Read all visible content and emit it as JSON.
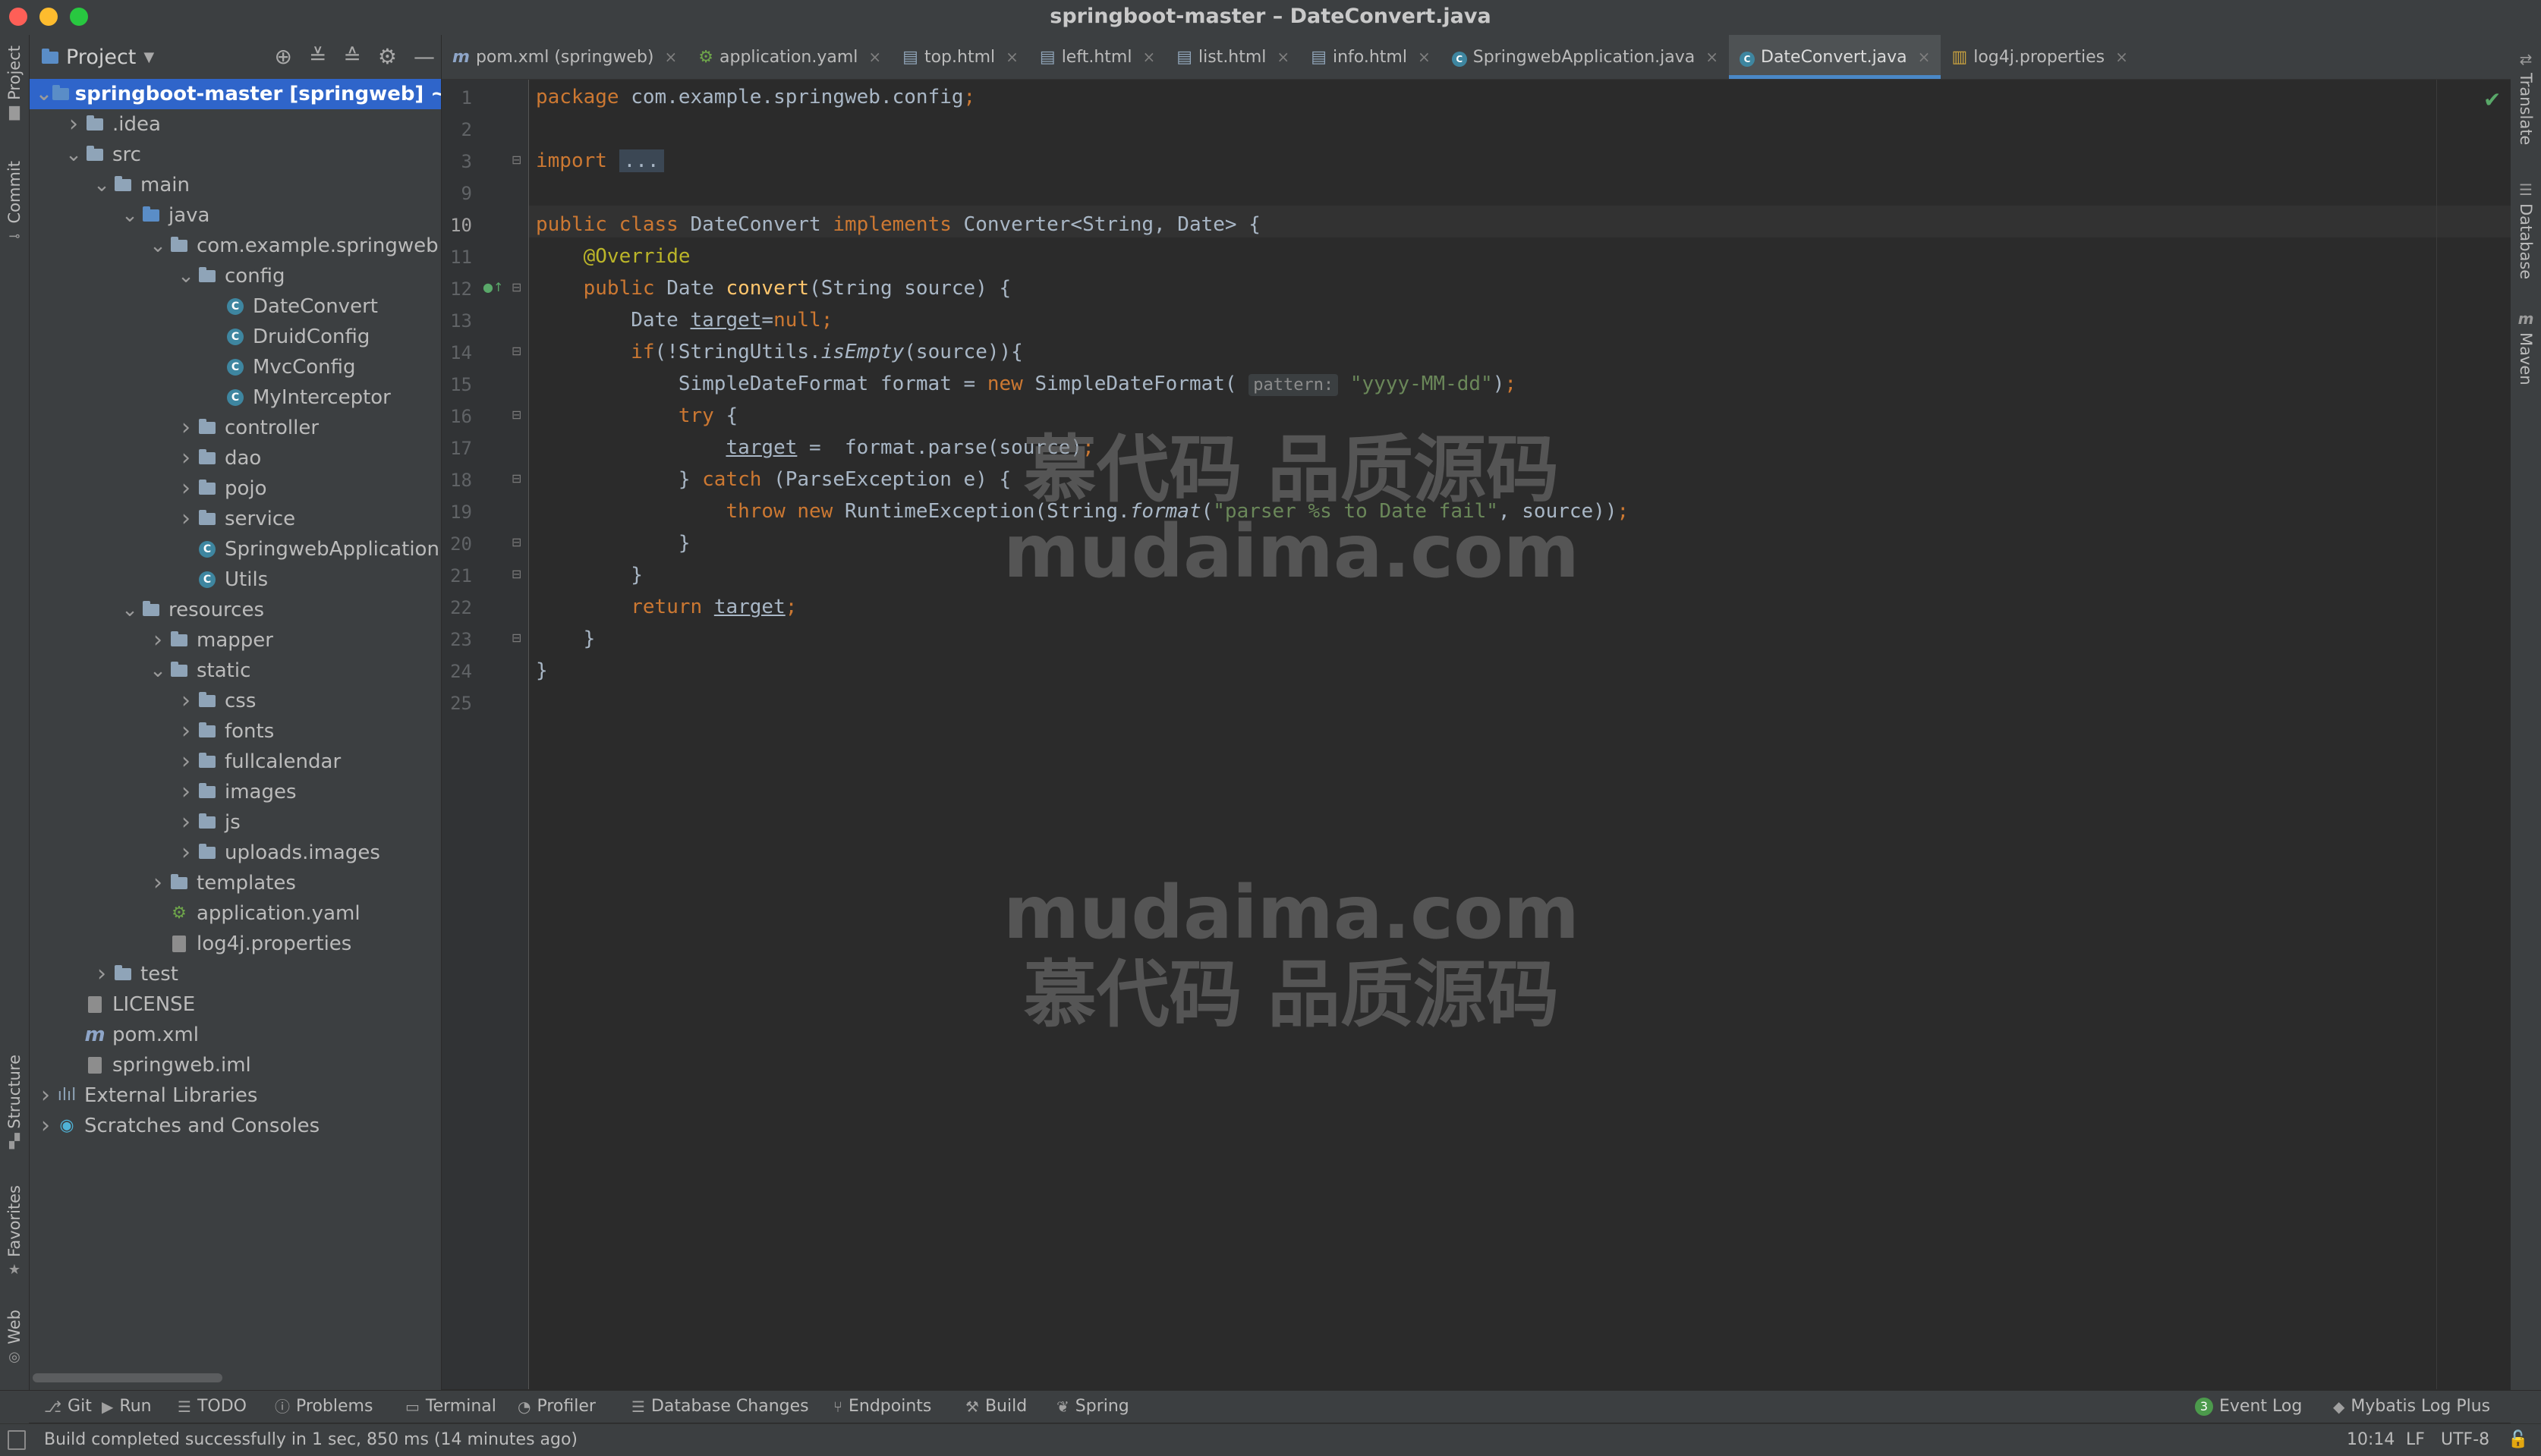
{
  "window": {
    "title": "springboot-master – DateConvert.java"
  },
  "left_strip": [
    {
      "label": "Project",
      "icon": "folder-icon"
    },
    {
      "label": "Commit",
      "icon": "commit-icon"
    },
    {
      "label": "Structure",
      "icon": "structure-icon"
    },
    {
      "label": "Favorites",
      "icon": "star-icon"
    },
    {
      "label": "Web",
      "icon": "web-icon"
    }
  ],
  "right_strip": [
    {
      "label": "Translate",
      "icon": "translate-icon"
    },
    {
      "label": "Database",
      "icon": "database-icon"
    },
    {
      "label": "Maven",
      "icon": "maven-icon"
    }
  ],
  "project_panel": {
    "title": "Project",
    "tree": [
      {
        "label": "springboot-master [springweb] ~/De",
        "depth": 0,
        "arrow": "down",
        "icon": "folder-blue",
        "selected": true
      },
      {
        "label": ".idea",
        "depth": 1,
        "arrow": "right",
        "icon": "folder"
      },
      {
        "label": "src",
        "depth": 1,
        "arrow": "down",
        "icon": "folder"
      },
      {
        "label": "main",
        "depth": 2,
        "arrow": "down",
        "icon": "folder"
      },
      {
        "label": "java",
        "depth": 3,
        "arrow": "down",
        "icon": "folder-blue"
      },
      {
        "label": "com.example.springweb",
        "depth": 4,
        "arrow": "down",
        "icon": "folder"
      },
      {
        "label": "config",
        "depth": 5,
        "arrow": "down",
        "icon": "folder"
      },
      {
        "label": "DateConvert",
        "depth": 6,
        "arrow": "",
        "icon": "class"
      },
      {
        "label": "DruidConfig",
        "depth": 6,
        "arrow": "",
        "icon": "class"
      },
      {
        "label": "MvcConfig",
        "depth": 6,
        "arrow": "",
        "icon": "class"
      },
      {
        "label": "MyInterceptor",
        "depth": 6,
        "arrow": "",
        "icon": "class"
      },
      {
        "label": "controller",
        "depth": 5,
        "arrow": "right",
        "icon": "folder"
      },
      {
        "label": "dao",
        "depth": 5,
        "arrow": "right",
        "icon": "folder"
      },
      {
        "label": "pojo",
        "depth": 5,
        "arrow": "right",
        "icon": "folder"
      },
      {
        "label": "service",
        "depth": 5,
        "arrow": "right",
        "icon": "folder"
      },
      {
        "label": "SpringwebApplication",
        "depth": 5,
        "arrow": "",
        "icon": "class"
      },
      {
        "label": "Utils",
        "depth": 5,
        "arrow": "",
        "icon": "class"
      },
      {
        "label": "resources",
        "depth": 3,
        "arrow": "down",
        "icon": "folder"
      },
      {
        "label": "mapper",
        "depth": 4,
        "arrow": "right",
        "icon": "folder"
      },
      {
        "label": "static",
        "depth": 4,
        "arrow": "down",
        "icon": "folder"
      },
      {
        "label": "css",
        "depth": 5,
        "arrow": "right",
        "icon": "folder"
      },
      {
        "label": "fonts",
        "depth": 5,
        "arrow": "right",
        "icon": "folder"
      },
      {
        "label": "fullcalendar",
        "depth": 5,
        "arrow": "right",
        "icon": "folder"
      },
      {
        "label": "images",
        "depth": 5,
        "arrow": "right",
        "icon": "folder"
      },
      {
        "label": "js",
        "depth": 5,
        "arrow": "right",
        "icon": "folder"
      },
      {
        "label": "uploads.images",
        "depth": 5,
        "arrow": "right",
        "icon": "folder"
      },
      {
        "label": "templates",
        "depth": 4,
        "arrow": "right",
        "icon": "folder"
      },
      {
        "label": "application.yaml",
        "depth": 4,
        "arrow": "",
        "icon": "yaml"
      },
      {
        "label": "log4j.properties",
        "depth": 4,
        "arrow": "",
        "icon": "file"
      },
      {
        "label": "test",
        "depth": 2,
        "arrow": "right",
        "icon": "folder"
      },
      {
        "label": "LICENSE",
        "depth": 1,
        "arrow": "",
        "icon": "file"
      },
      {
        "label": "pom.xml",
        "depth": 1,
        "arrow": "",
        "icon": "maven"
      },
      {
        "label": "springweb.iml",
        "depth": 1,
        "arrow": "",
        "icon": "file"
      },
      {
        "label": "External Libraries",
        "depth": 0,
        "arrow": "right",
        "icon": "library"
      },
      {
        "label": "Scratches and Consoles",
        "depth": 0,
        "arrow": "right",
        "icon": "scratch"
      }
    ]
  },
  "tabs": [
    {
      "label": "pom.xml (springweb)",
      "icon": "maven",
      "active": false
    },
    {
      "label": "application.yaml",
      "icon": "yaml",
      "active": false
    },
    {
      "label": "top.html",
      "icon": "html",
      "active": false
    },
    {
      "label": "left.html",
      "icon": "html",
      "active": false
    },
    {
      "label": "list.html",
      "icon": "html",
      "active": false
    },
    {
      "label": "info.html",
      "icon": "html",
      "active": false
    },
    {
      "label": "SpringwebApplication.java",
      "icon": "spring-class",
      "active": false
    },
    {
      "label": "DateConvert.java",
      "icon": "class",
      "active": true
    },
    {
      "label": "log4j.properties",
      "icon": "properties",
      "active": false
    }
  ],
  "editor": {
    "current_line": 10,
    "lines": [
      {
        "n": 1,
        "html": "<span class=\"kw\">package</span> com.example.springweb.config<span class=\"kw\">;</span>"
      },
      {
        "n": 2,
        "html": ""
      },
      {
        "n": 3,
        "html": "<span class=\"kw\">import</span> <span class=\"foldbox\">...</span>"
      },
      {
        "n": 9,
        "html": ""
      },
      {
        "n": 10,
        "html": "<span class=\"kw\">public class</span> DateConvert <span class=\"kw\">implements</span> Converter&lt;String, Date&gt; {"
      },
      {
        "n": 11,
        "html": "    <span class=\"an\">@Override</span>"
      },
      {
        "n": 12,
        "html": "    <span class=\"kw\">public</span> Date <span class=\"fn\">convert</span>(String source) {"
      },
      {
        "n": 13,
        "html": "        Date <span class=\"ul\">target</span>=<span class=\"kw\">null;</span>"
      },
      {
        "n": 14,
        "html": "        <span class=\"kw\">if</span>(!StringUtils.<span class=\"it\">isEmpty</span>(source)){"
      },
      {
        "n": 15,
        "html": "            SimpleDateFormat format = <span class=\"kw\">new</span> SimpleDateFormat( <span class=\"hint\">pattern:</span> <span class=\"str\">\"yyyy-MM-dd\"</span>)<span class=\"kw\">;</span>"
      },
      {
        "n": 16,
        "html": "            <span class=\"kw\">try</span> {"
      },
      {
        "n": 17,
        "html": "                <span class=\"ul\">target</span> =  format.parse(source)<span class=\"kw\">;</span>"
      },
      {
        "n": 18,
        "html": "            } <span class=\"kw\">catch</span> (ParseException e) {"
      },
      {
        "n": 19,
        "html": "                <span class=\"kw\">throw new</span> RuntimeException(String.<span class=\"it\">format</span>(<span class=\"str\">\"parser %s to Date fail\"</span>, source))<span class=\"kw\">;</span>"
      },
      {
        "n": 20,
        "html": "            }"
      },
      {
        "n": 21,
        "html": "        }"
      },
      {
        "n": 22,
        "html": "        <span class=\"kw\">return</span> <span class=\"ul\">target</span><span class=\"kw\">;</span>"
      },
      {
        "n": 23,
        "html": "    }"
      },
      {
        "n": 24,
        "html": "}"
      },
      {
        "n": 25,
        "html": ""
      }
    ]
  },
  "watermarks": [
    {
      "line1": "慕代码 品质源码",
      "line2": "mudaima.com"
    },
    {
      "line1": "mudaima.com",
      "line2": "慕代码 品质源码"
    }
  ],
  "bottom_tools": [
    {
      "label": "Git",
      "icon": "git-icon"
    },
    {
      "label": "Run",
      "icon": "run-icon"
    },
    {
      "label": "TODO",
      "icon": "todo-icon"
    },
    {
      "label": "Problems",
      "icon": "problems-icon"
    },
    {
      "label": "Terminal",
      "icon": "terminal-icon"
    },
    {
      "label": "Profiler",
      "icon": "profiler-icon"
    },
    {
      "label": "Database Changes",
      "icon": "database-changes-icon"
    },
    {
      "label": "Endpoints",
      "icon": "endpoints-icon"
    },
    {
      "label": "Build",
      "icon": "build-icon"
    },
    {
      "label": "Spring",
      "icon": "spring-icon"
    }
  ],
  "bottom_right_tools": [
    {
      "label": "Event Log",
      "badge": "3",
      "icon": "event-log-icon"
    },
    {
      "label": "Mybatis Log Plus",
      "icon": "mybatis-icon"
    }
  ],
  "status": {
    "message": "Build completed successfully in 1 sec, 850 ms (14 minutes ago)",
    "position": "10:14",
    "line_sep": "LF",
    "encoding": "UTF-8"
  }
}
